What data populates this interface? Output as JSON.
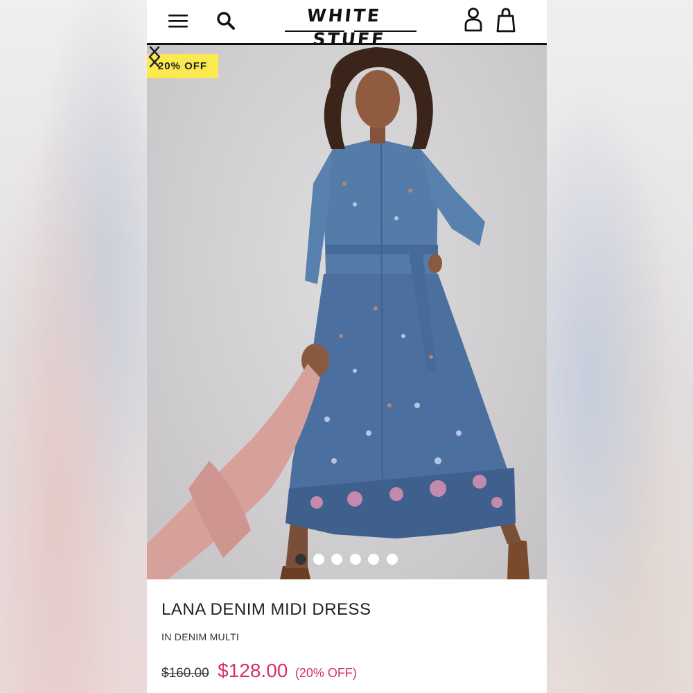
{
  "header": {
    "brand_word_1": "WHITE",
    "brand_word_2": "STUFF",
    "icons": [
      "menu-icon",
      "search-icon",
      "account-icon",
      "bag-icon"
    ]
  },
  "gallery": {
    "badge": "20% OFF",
    "slide_count": 6,
    "active_slide": 1,
    "prev_icon": "chevron-left-icon",
    "next_icon": "chevron-right-icon"
  },
  "product": {
    "title": "LANA DENIM MIDI DRESS",
    "variant": "IN DENIM MULTI",
    "old_price": "$160.00",
    "new_price": "$128.00",
    "discount": "(20% OFF)"
  },
  "colors": {
    "badge": "#fbe94f",
    "sale": "#d62d6f",
    "text": "#222222"
  }
}
